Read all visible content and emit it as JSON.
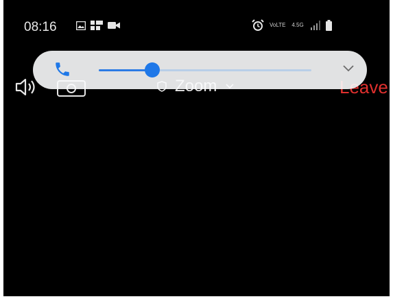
{
  "status_bar": {
    "time": "08:16",
    "left_icons": [
      "image-icon",
      "grid-app-icon",
      "video-icon"
    ],
    "right_icons": [
      "alarm-icon",
      "volte-icon",
      "4g-icon",
      "signal-icon",
      "battery-icon"
    ],
    "volte_label": "VoLTE",
    "network_label": "4.5G"
  },
  "meeting": {
    "title": "Zoom",
    "leave_label": "Leave"
  },
  "volume_panel": {
    "stream_icon": "phone-icon",
    "level": 0.25,
    "accent": "#1f78e8"
  }
}
